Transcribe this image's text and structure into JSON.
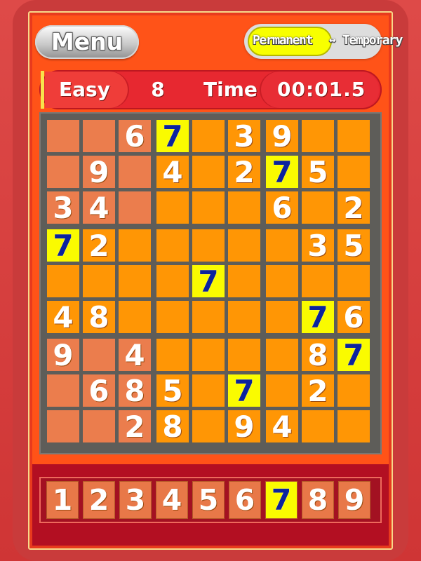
{
  "header": {
    "menu_label": "Menu",
    "mode_toggle": {
      "permanent_label": "Permanent",
      "arrow": "↔",
      "temporary_label": "Temporary",
      "selected": "Permanent"
    }
  },
  "status": {
    "difficulty": "Easy",
    "level": "8",
    "time_label": "Time",
    "elapsed": "00:01.5"
  },
  "grid": {
    "rows": [
      [
        "",
        "",
        "6",
        "7",
        "",
        "3",
        "9",
        "",
        ""
      ],
      [
        "",
        "9",
        "",
        "4",
        "",
        "2",
        "7",
        "5",
        ""
      ],
      [
        "3",
        "4",
        "",
        "",
        "",
        "",
        "6",
        "",
        "2"
      ],
      [
        "7",
        "2",
        "",
        "",
        "",
        "",
        "",
        "3",
        "5"
      ],
      [
        "",
        "",
        "",
        "",
        "7",
        "",
        "",
        "",
        ""
      ],
      [
        "4",
        "8",
        "",
        "",
        "",
        "",
        "",
        "7",
        "6"
      ],
      [
        "9",
        "",
        "4",
        "",
        "",
        "",
        "",
        "8",
        "7"
      ],
      [
        "",
        "6",
        "8",
        "5",
        "",
        "7",
        "",
        "2",
        ""
      ],
      [
        "",
        "",
        "2",
        "8",
        "",
        "9",
        "4",
        "",
        ""
      ]
    ],
    "highlighted_number": "7",
    "given_cells": [
      [
        0,
        0
      ],
      [
        0,
        1
      ],
      [
        0,
        2
      ],
      [
        1,
        0
      ],
      [
        1,
        1
      ],
      [
        1,
        2
      ],
      [
        2,
        0
      ],
      [
        2,
        1
      ],
      [
        2,
        2
      ],
      [
        6,
        0
      ],
      [
        6,
        1
      ],
      [
        6,
        2
      ],
      [
        7,
        0
      ],
      [
        7,
        1
      ],
      [
        7,
        2
      ],
      [
        8,
        0
      ],
      [
        8,
        1
      ],
      [
        8,
        2
      ]
    ]
  },
  "number_pad": {
    "keys": [
      "1",
      "2",
      "3",
      "4",
      "5",
      "6",
      "7",
      "8",
      "9"
    ],
    "selected": "7"
  },
  "colors": {
    "background_red": "#d83a3a",
    "panel_orange": "#ff5318",
    "cell_orange": "#ff9605",
    "given_cell": "#eb7d4d",
    "highlight_yellow": "#fafb00",
    "highlight_text_blue": "#0b239e"
  }
}
